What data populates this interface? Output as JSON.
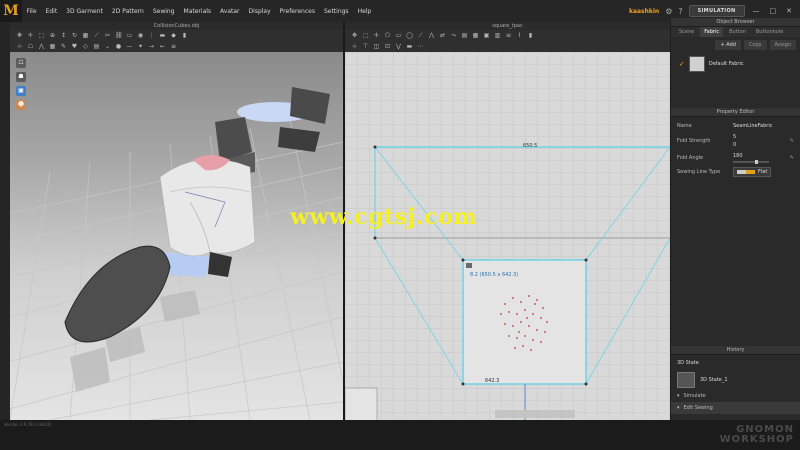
{
  "app": {
    "logo": "M",
    "menu": [
      "File",
      "Edit",
      "3D Garment",
      "2D Pattern",
      "Sewing",
      "Materials",
      "Avatar",
      "Display",
      "Preferences",
      "Settings",
      "Help"
    ],
    "user": "kaashkin",
    "mode": "SIMULATION"
  },
  "panel3d": {
    "title": "CollisionCubes.obj"
  },
  "panel2d": {
    "title": "square_tpac",
    "top_width_label": "650.5",
    "pattern_label": "8.2 (650.5 x 642.3)",
    "bottom_width_label": "642.3"
  },
  "object_browser": {
    "title": "Object Browser",
    "tabs": [
      "Scene",
      "Fabric",
      "Button",
      "Buttonhole"
    ],
    "active_tab": "Fabric",
    "actions": [
      "+ Add",
      "Copy",
      "Assign"
    ],
    "fabric_name": "Default Fabric"
  },
  "property_editor": {
    "title": "Property Editor",
    "name_label": "Name",
    "name_value": "SeamLineFabric",
    "fold_strength_label": "Fold Strength",
    "fold_strength_values": [
      "5",
      "0"
    ],
    "fold_angle_label": "Fold Angle",
    "fold_angle_value": "180",
    "sewing_line_type_label": "Sewing Line Type",
    "sewing_line_type_value": "Flat"
  },
  "history": {
    "title": "History",
    "section": "3D State",
    "state_name": "3D State_1",
    "items": [
      "Simulate",
      "Edit Sewing"
    ]
  },
  "status": {
    "text": "Version 3.0.78   (r14812)"
  },
  "watermark": "www.cgtsj.com",
  "branding": {
    "line1": "GNOMON",
    "line2": "WORKSHOP"
  },
  "colors": {
    "accent": "#f0a020",
    "pattern_line": "#6fd3e8",
    "points": "#c0303a"
  }
}
